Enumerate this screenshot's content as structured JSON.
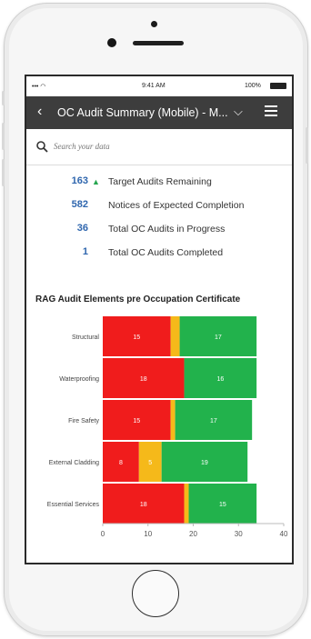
{
  "status_bar": {
    "signal": "••• ◠",
    "time": "9:41 AM",
    "battery": "100%"
  },
  "header": {
    "title": "OC Audit Summary (Mobile) - M...",
    "back_icon": "chevron-left-icon",
    "dropdown_icon": "chevron-down-icon",
    "menu_icon": "hamburger-icon",
    "background": "#3d3d3d"
  },
  "search": {
    "placeholder": "Search your data"
  },
  "kpis": [
    {
      "value": "163",
      "indicator": "▲",
      "label": "Target Audits Remaining"
    },
    {
      "value": "582",
      "label": "Notices of Expected Completion"
    },
    {
      "value": "36",
      "label": "Total OC Audits in Progress"
    },
    {
      "value": "1",
      "label": "Total OC Audits Completed"
    }
  ],
  "chart_data": {
    "type": "bar",
    "orientation": "horizontal",
    "stacked": true,
    "title": "RAG Audit Elements pre Occupation Certificate",
    "categories": [
      "Structural",
      "Waterproofing",
      "Fire Safety",
      "External Cladding",
      "Essential Services"
    ],
    "series": [
      {
        "color": "#f01c1c",
        "values": [
          15,
          18,
          15,
          8,
          18
        ],
        "labels": [
          "15",
          "18",
          "15",
          "8",
          "18"
        ]
      },
      {
        "color": "#f5b91a",
        "values": [
          2,
          0,
          1,
          5,
          1
        ],
        "labels": [
          "",
          "",
          "",
          "5",
          ""
        ]
      },
      {
        "color": "#22b24c",
        "values": [
          17,
          16,
          17,
          19,
          15
        ],
        "labels": [
          "17",
          "16",
          "17",
          "19",
          "15"
        ]
      }
    ],
    "xlim": [
      0,
      40
    ],
    "xticks": [
      "0",
      "10",
      "20",
      "30",
      "40"
    ]
  },
  "colors": {
    "kpi_value": "#2f66ae",
    "trend_up": "#27a650"
  }
}
